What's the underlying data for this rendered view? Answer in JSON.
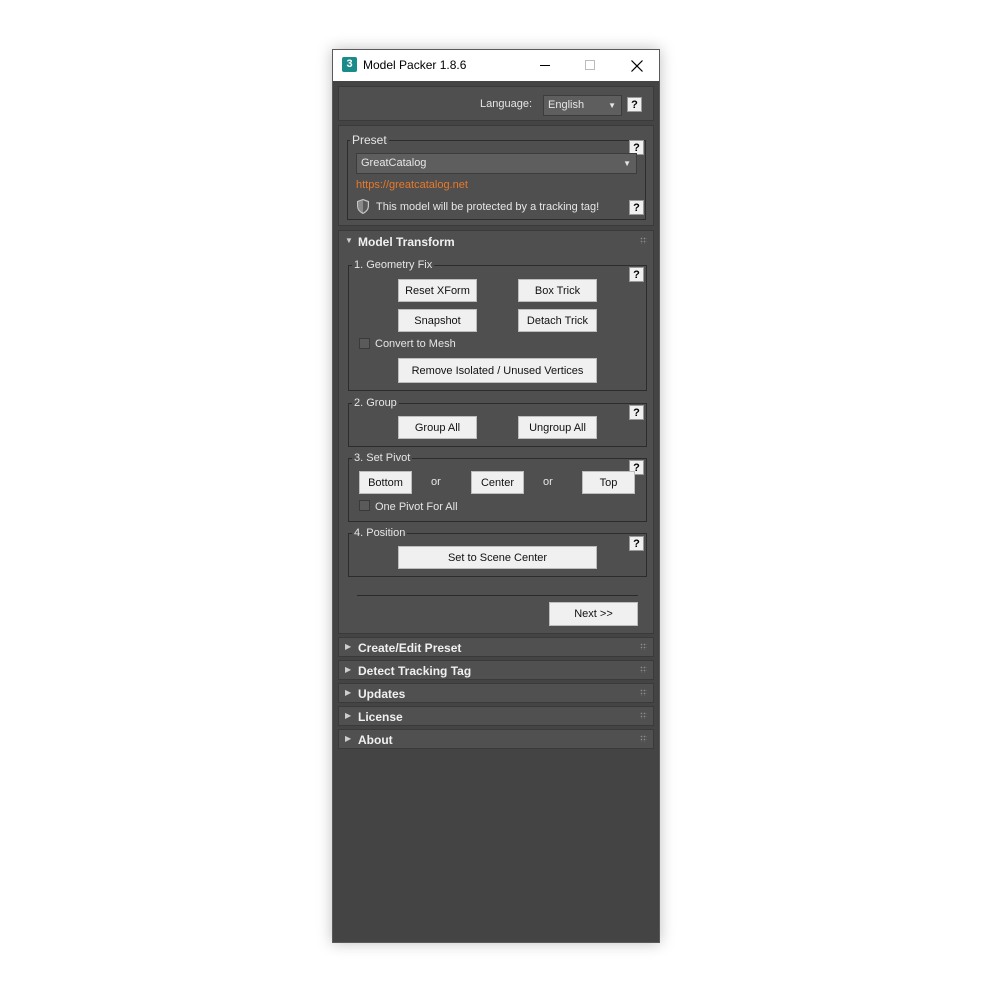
{
  "window": {
    "title": "Model Packer 1.8.6",
    "app_icon_text": "3",
    "icons": [
      "minimize-icon",
      "maximize-icon",
      "close-icon"
    ]
  },
  "language": {
    "label": "Language:",
    "value": "English",
    "help": "?"
  },
  "preset": {
    "group_label": "Preset",
    "selected": "GreatCatalog",
    "link": "https://greatcatalog.net",
    "tracking_text": "This model will be protected by a tracking tag!",
    "help": "?"
  },
  "model_transform": {
    "title": "Model Transform",
    "geometry_fix": {
      "label": "1. Geometry Fix",
      "reset_xform": "Reset XForm",
      "box_trick": "Box Trick",
      "snapshot": "Snapshot",
      "detach_trick": "Detach Trick",
      "convert_to_mesh": "Convert to Mesh",
      "remove_vertices": "Remove Isolated / Unused Vertices"
    },
    "group": {
      "label": "2. Group",
      "group_all": "Group All",
      "ungroup_all": "Ungroup All"
    },
    "set_pivot": {
      "label": "3. Set Pivot",
      "bottom": "Bottom",
      "or1": "or",
      "center": "Center",
      "or2": "or",
      "top": "Top",
      "one_pivot": "One Pivot For All"
    },
    "position": {
      "label": "4. Position",
      "set_center": "Set to Scene Center"
    },
    "next": "Next >>"
  },
  "rollouts": [
    {
      "title": "Create/Edit Preset"
    },
    {
      "title": "Detect Tracking Tag"
    },
    {
      "title": "Updates"
    },
    {
      "title": "License"
    },
    {
      "title": "About"
    }
  ],
  "colors": {
    "panel_bg": "#444444",
    "rollout_bg": "#4f4f4f",
    "link": "#e8792a",
    "button": "#f0f0f0"
  }
}
